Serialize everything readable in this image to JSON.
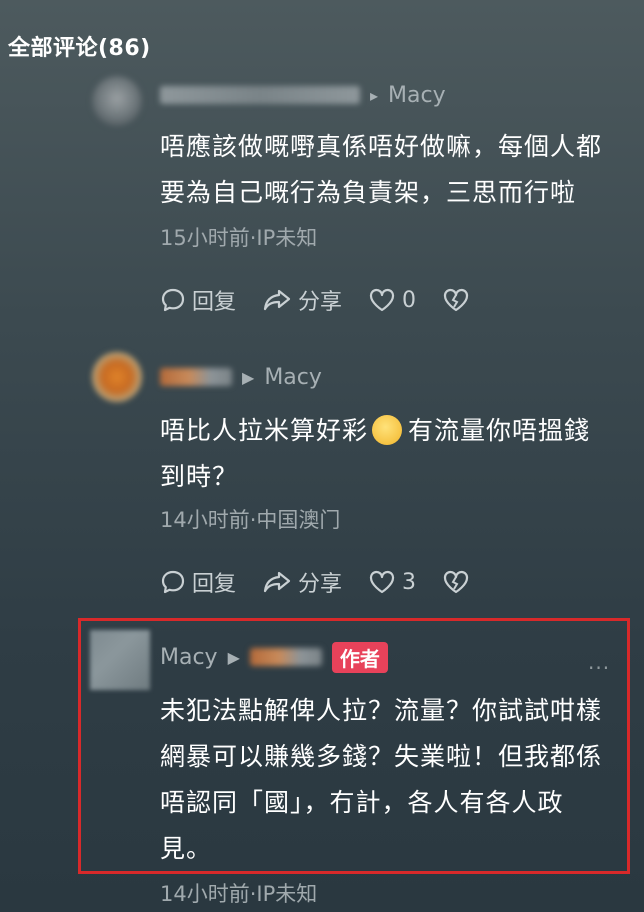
{
  "header": {
    "title": "全部评论(86)"
  },
  "comments": [
    {
      "reply_to": "Macy",
      "text_lines": [
        "唔應該做嘅嘢真係唔好做嘛，每個人都",
        "要為自己嘅行為負責架，三思而行啦"
      ],
      "meta": "15小时前·IP未知",
      "reply_label": "回复",
      "share_label": "分享",
      "like_count": "0"
    },
    {
      "reply_to": "Macy",
      "text_line1_before": "唔比人拉米算好彩",
      "text_line1_after": "有流量你唔搵錢",
      "text_line2": "到時？",
      "meta": "14小时前·中国澳门",
      "reply_label": "回复",
      "share_label": "分享",
      "like_count": "3"
    },
    {
      "author_name": "Macy",
      "badge": "作者",
      "text_lines": [
        "未犯法點解俾人拉？流量？你試試咁樣",
        "網暴可以賺幾多錢？失業啦！但我都係",
        "唔認同「國」，冇計，各人有各人政",
        "見。"
      ],
      "meta": "14小时前·IP未知",
      "more": "···"
    }
  ],
  "icons": [
    "comment-icon",
    "share-icon",
    "heart-icon",
    "broken-heart-icon",
    "caret-right-icon",
    "pleading-emoji-icon"
  ],
  "colors": {
    "badge": "#e8425a",
    "highlight": "#d8292a"
  }
}
